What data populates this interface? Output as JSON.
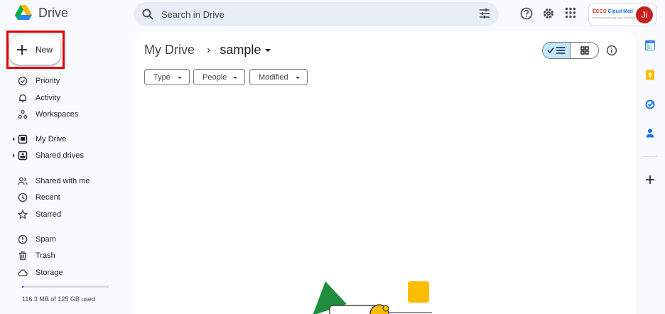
{
  "app": {
    "name": "Drive"
  },
  "search": {
    "placeholder": "Search in Drive"
  },
  "org": {
    "logo_text_a": "ECCS",
    "logo_text_b": "Cloud Mail",
    "logo_subtext": "Information technology center, The University of Tokyo"
  },
  "user": {
    "avatar_initials": "Ji"
  },
  "sidebar": {
    "new_label": "New",
    "items": [
      {
        "label": "Priority",
        "icon": "priority-icon"
      },
      {
        "label": "Activity",
        "icon": "bell-icon"
      },
      {
        "label": "Workspaces",
        "icon": "workspaces-icon"
      },
      {
        "label": "My Drive",
        "icon": "my-drive-icon"
      },
      {
        "label": "Shared drives",
        "icon": "shared-drives-icon"
      },
      {
        "label": "Shared with me",
        "icon": "shared-with-me-icon"
      },
      {
        "label": "Recent",
        "icon": "clock-icon"
      },
      {
        "label": "Starred",
        "icon": "star-icon"
      },
      {
        "label": "Spam",
        "icon": "spam-icon"
      },
      {
        "label": "Trash",
        "icon": "trash-icon"
      },
      {
        "label": "Storage",
        "icon": "cloud-icon"
      }
    ],
    "storage": {
      "text": "116.3 MB of 125 GB used",
      "used_fraction": 0.0009
    }
  },
  "main": {
    "breadcrumb": {
      "root": "My Drive",
      "separator": "›",
      "current": "sample"
    },
    "filters": [
      "Type",
      "People",
      "Modified"
    ]
  },
  "colors": {
    "accent": "#0b57d0",
    "toggle_active": "#c2e7ff",
    "highlight": "#e00000"
  }
}
